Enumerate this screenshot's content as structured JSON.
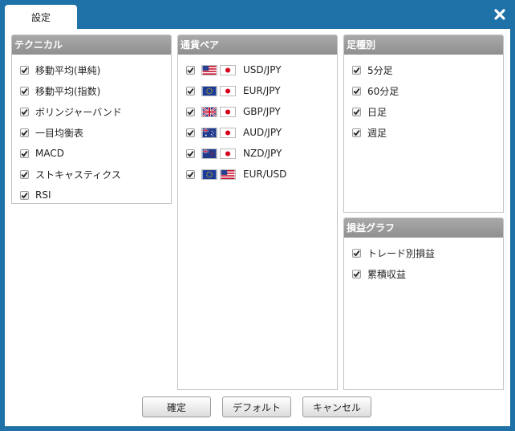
{
  "window": {
    "tab_label": "設定",
    "close_label": "close"
  },
  "technical": {
    "title": "テクニカル",
    "items": [
      {
        "label": "移動平均(単純)",
        "checked": true
      },
      {
        "label": "移動平均(指数)",
        "checked": true
      },
      {
        "label": "ボリンジャーバンド",
        "checked": true
      },
      {
        "label": "一目均衡表",
        "checked": true
      },
      {
        "label": "MACD",
        "checked": true
      },
      {
        "label": "ストキャスティクス",
        "checked": true
      },
      {
        "label": "RSI",
        "checked": true
      }
    ]
  },
  "pairs": {
    "title": "通貨ペア",
    "items": [
      {
        "label": "USD/JPY",
        "checked": true,
        "flags": [
          "us-flag-icon",
          "jp-flag-icon"
        ]
      },
      {
        "label": "EUR/JPY",
        "checked": true,
        "flags": [
          "eu-flag-icon",
          "jp-flag-icon"
        ]
      },
      {
        "label": "GBP/JPY",
        "checked": true,
        "flags": [
          "uk-flag-icon",
          "jp-flag-icon"
        ]
      },
      {
        "label": "AUD/JPY",
        "checked": true,
        "flags": [
          "au-flag-icon",
          "jp-flag-icon"
        ]
      },
      {
        "label": "NZD/JPY",
        "checked": true,
        "flags": [
          "nz-flag-icon",
          "jp-flag-icon"
        ]
      },
      {
        "label": "EUR/USD",
        "checked": true,
        "flags": [
          "eu-flag-icon",
          "us-flag-icon"
        ]
      }
    ]
  },
  "period": {
    "title": "足種別",
    "items": [
      {
        "label": "5分足",
        "checked": true
      },
      {
        "label": "60分足",
        "checked": true
      },
      {
        "label": "日足",
        "checked": true
      },
      {
        "label": "週足",
        "checked": true
      }
    ]
  },
  "pnl": {
    "title": "損益グラフ",
    "items": [
      {
        "label": "トレード別損益",
        "checked": true
      },
      {
        "label": "累積収益",
        "checked": true
      }
    ]
  },
  "buttons": {
    "ok": "確定",
    "default": "デフォルト",
    "cancel": "キャンセル"
  },
  "colors": {
    "frame": "#1e72a7",
    "header": "#999999"
  }
}
